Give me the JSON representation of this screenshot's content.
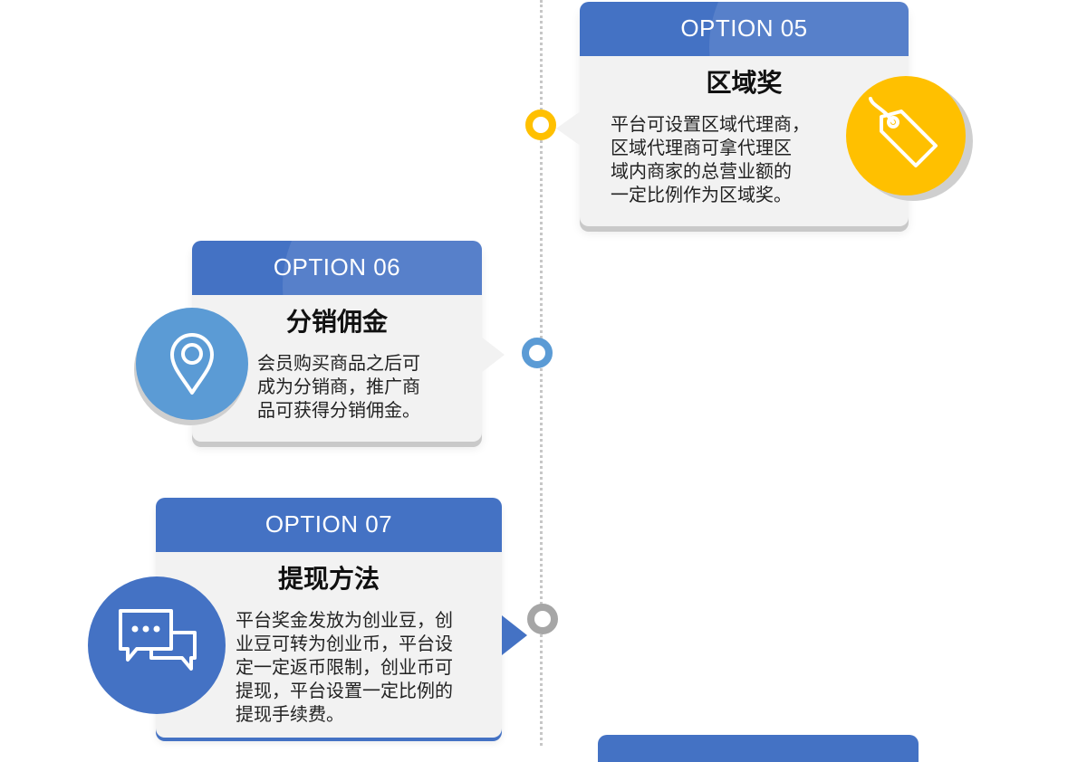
{
  "colors": {
    "primary_blue": "#4472c4",
    "light_blue": "#5b9bd5",
    "yellow": "#ffc000",
    "gray_node": "#a6a6a6"
  },
  "cards": [
    {
      "option_label": "OPTION 05",
      "title": "区域奖",
      "body": "平台可设置区域代理商，\n区域代理商可拿代理区\n域内商家的总营业额的\n一定比例作为区域奖。",
      "icon": "tag-icon"
    },
    {
      "option_label": "OPTION 06",
      "title": "分销佣金",
      "body": "会员购买商品之后可\n成为分销商，推广商\n品可获得分销佣金。",
      "icon": "location-pin-icon"
    },
    {
      "option_label": "OPTION  07",
      "title": "提现方法",
      "body": "平台奖金发放为创业豆，创\n业豆可转为创业币，平台设\n定一定返币限制，创业币可\n提现，平台设置一定比例的\n提现手续费。",
      "icon": "chat-bubbles-icon"
    }
  ]
}
